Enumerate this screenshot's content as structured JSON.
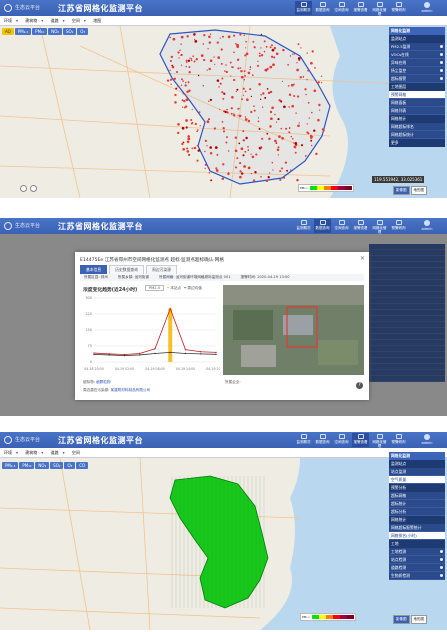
{
  "app": {
    "title": "江苏省网格化监测平台",
    "brand": "生态云平台",
    "nav_items": [
      "监测概况",
      "数据查询",
      "空间查询",
      "报警查看",
      "网格化管理",
      "预警研判",
      "系统设置"
    ],
    "user": "admin"
  },
  "filters": {
    "items": [
      "环境",
      "建筑物",
      "道路",
      "空间",
      "地图"
    ]
  },
  "layers": {
    "buttons": [
      "AQ",
      "PM₂.₅",
      "PM₁₀",
      "NO₂",
      "SO₂",
      "O₃",
      "CO"
    ]
  },
  "panel1": {
    "header": "网格化监测",
    "group1": "监测站点",
    "items1": [
      "PM2.5监测",
      "VOCs在线",
      "异味在线",
      "扬尘监控",
      "超标报警"
    ],
    "group2": "工地图层",
    "items2": [
      "预警网格",
      "网格面板",
      "网格列表"
    ],
    "group3": "网格统计",
    "items3": [
      "网格超标排名",
      "网格超标统计"
    ],
    "footer": "更多"
  },
  "panel3": {
    "header": "网格化监测",
    "group1": "监测站点",
    "items1": [
      "站点监测",
      "空气质量"
    ],
    "group2": "预警分析",
    "items2": [
      "超标网格",
      "超标统计",
      "超标分析"
    ],
    "group3": "网格统计",
    "items3": [
      "网格超标报警统计",
      "网格排名(小时)"
    ],
    "group4": "工地",
    "items4": [
      "工地检测",
      "站点检测",
      "道路检测",
      "生物质检测"
    ]
  },
  "legend": {
    "label": "PM₂.₅",
    "colors": [
      "#00e400",
      "#ffff00",
      "#ff7e00",
      "#ff0000",
      "#99004c",
      "#7e0023"
    ],
    "ticks": [
      "0",
      "35",
      "75",
      "115",
      "150",
      "250",
      "500"
    ]
  },
  "coords": "119.551942, 33.025361",
  "basemap": [
    "影像图",
    "地形图",
    "矢量图"
  ],
  "modal": {
    "title": "E14475Ee 江苏省邳州市空间网格化监测点 超标·监测点超标确认·网格",
    "close": "×",
    "tabs": [
      "基本信息",
      "历史数据查询",
      "周边污染源"
    ],
    "info": [
      "所属区县: 邳州",
      "所属乡镇: 运河街道",
      "所属网格: 运河街道环境网格超标监测点 001",
      "报警时间: 2020-04-19 13:00"
    ],
    "chart_title": "浓度变化趋势(近24小时)",
    "select": "PM2.5",
    "legend_self": "本站点",
    "legend_avg": "周边均值",
    "footer_k1": "超标物:",
    "footer_v1": "细颗粒物",
    "footer_k2": "所属企业:",
    "footer_k3": "周边潜在污染源:",
    "footer_v3": "某建筑材料制品有限公司"
  },
  "chart_data": {
    "type": "line",
    "title": "浓度变化趋势(近24小时)",
    "categories": [
      "04-18 20:00",
      "04-18 23:00",
      "04-19 02:00",
      "04-19 05:00",
      "04-19 08:00",
      "04-19 11:00",
      "04-19 14:00",
      "04-19 17:00",
      "04-19 20:00"
    ],
    "series": [
      {
        "name": "本站点",
        "values": [
          42,
          38,
          35,
          40,
          62,
          250,
          58,
          48,
          45
        ]
      },
      {
        "name": "周边均值",
        "values": [
          35,
          33,
          30,
          33,
          40,
          45,
          40,
          38,
          36
        ]
      }
    ],
    "ylim": [
      0,
      300
    ],
    "grid": true,
    "legend": "top"
  }
}
